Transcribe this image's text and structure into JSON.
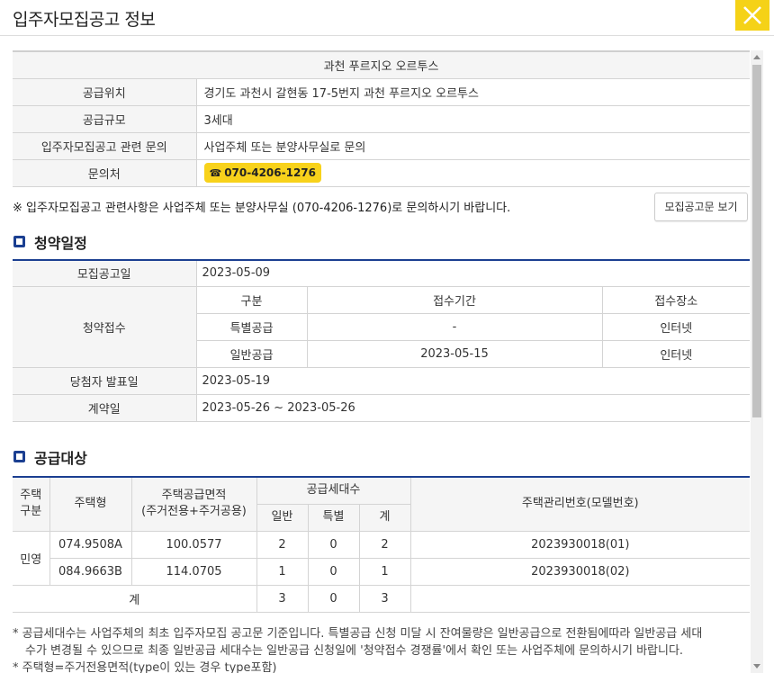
{
  "window": {
    "title": "입주자모집공고 정보"
  },
  "info": {
    "complex_name": "과천 푸르지오 오르투스",
    "rows": [
      {
        "label": "공급위치",
        "value": "경기도 과천시 갈현동 17-5번지 과천 푸르지오 오르투스"
      },
      {
        "label": "공급규모",
        "value": "3세대"
      },
      {
        "label": "입주자모집공고 관련 문의",
        "value": "사업주체 또는 분양사무실로 문의"
      }
    ],
    "contact_label": "문의처",
    "contact_phone": "070-4206-1276"
  },
  "notice": {
    "text": "※ 입주자모집공고 관련사항은 사업주체 또는 분양사무실 (070-4206-1276)로 문의하시기 바랍니다.",
    "view_button": "모집공고문 보기"
  },
  "schedule": {
    "title": "청약일정",
    "announce_label": "모집공고일",
    "announce_date": "2023-05-09",
    "receipt_label": "청약접수",
    "headers": [
      "구분",
      "접수기간",
      "접수장소"
    ],
    "rows": [
      {
        "type": "특별공급",
        "period": "-",
        "place": "인터넷"
      },
      {
        "type": "일반공급",
        "period": "2023-05-15",
        "place": "인터넷"
      }
    ],
    "winner_label": "당첨자 발표일",
    "winner_date": "2023-05-19",
    "contract_label": "계약일",
    "contract_date": "2023-05-26 ~ 2023-05-26"
  },
  "supply": {
    "title": "공급대상",
    "headers": {
      "house_kind_1": "주택",
      "house_kind_2": "구분",
      "house_type": "주택형",
      "area_1": "주택공급면적",
      "area_2": "(주거전용+주거공용)",
      "units": "공급세대수",
      "general": "일반",
      "special": "특별",
      "total": "계",
      "model_no": "주택관리번호(모델번호)"
    },
    "kind": "민영",
    "rows": [
      {
        "type": "074.9508A",
        "area": "100.0577",
        "general": "2",
        "special": "0",
        "total": "2",
        "model": "2023930018(01)"
      },
      {
        "type": "084.9663B",
        "area": "114.0705",
        "general": "1",
        "special": "0",
        "total": "1",
        "model": "2023930018(02)"
      }
    ],
    "footer": {
      "label": "계",
      "general": "3",
      "special": "0",
      "total": "3"
    }
  },
  "notes": {
    "line1": "* 공급세대수는 사업주체의 최초 입주자모집 공고문 기준입니다. 특별공급 신청 미달 시 잔여물량은 일반공급으로 전환됨에따라 일반공급 세대",
    "line2": "수가 변경될 수 있으므로 최종 일반공급 세대수는 일반공급 신청일에 '청약접수 경쟁률'에서 확인 또는 사업주체에 문의하시기 바랍니다.",
    "line3": "* 주택형=주거전용면적(type이 있는 경우 type포함)"
  },
  "colors": {
    "accent_yellow": "#f5d217",
    "section_blue": "#1b3f91"
  }
}
